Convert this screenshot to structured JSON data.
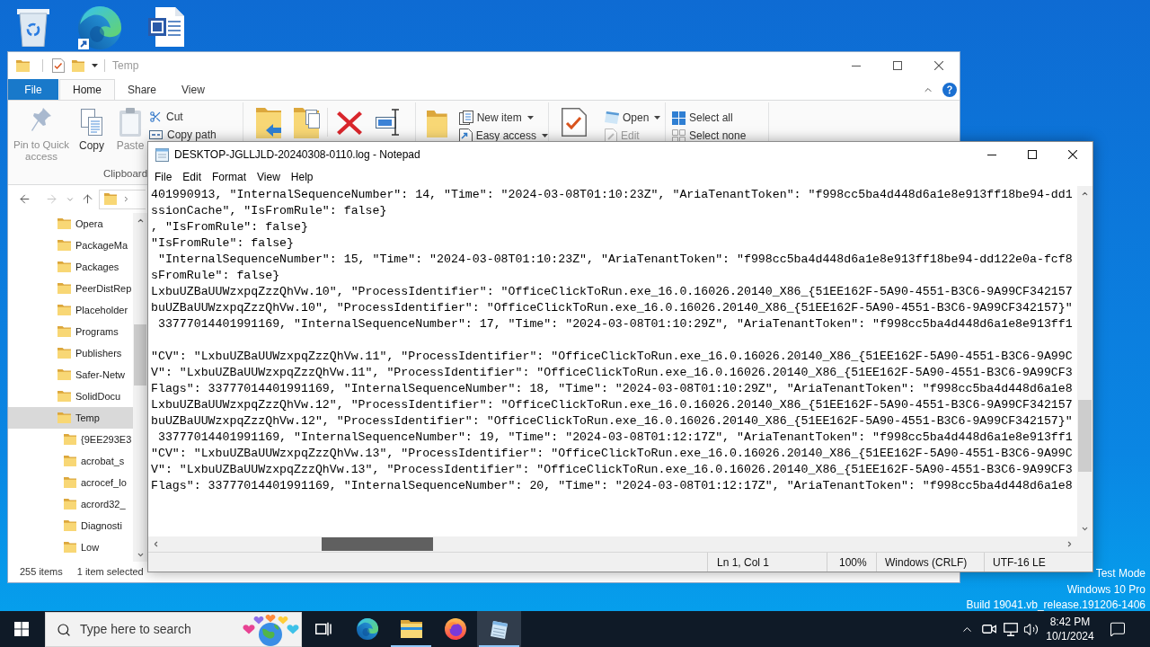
{
  "explorer": {
    "title": "Temp",
    "tabs": [
      {
        "label": "File",
        "kind": "file",
        "selected": false
      },
      {
        "label": "Home",
        "kind": "tab",
        "selected": true
      },
      {
        "label": "Share",
        "kind": "tab",
        "selected": false
      },
      {
        "label": "View",
        "kind": "tab",
        "selected": false
      }
    ],
    "ribbon": {
      "clipboard": {
        "label": "Clipboard",
        "pin": {
          "label": "Pin to Quick access",
          "disabled": true
        },
        "copy": {
          "label": "Copy",
          "disabled": false
        },
        "paste": {
          "label": "Paste",
          "disabled": true
        },
        "cut": {
          "label": "Cut",
          "disabled": false
        },
        "copy_path": {
          "label": "Copy path",
          "disabled": false
        }
      },
      "new": {
        "new_item": "New item",
        "easy_access": "Easy access"
      },
      "open": {
        "open": {
          "label": "Open",
          "disabled": false
        },
        "edit": {
          "label": "Edit",
          "disabled": true
        }
      },
      "select": {
        "select_all": "Select all",
        "select_none": "Select none"
      }
    },
    "tree": [
      {
        "label": "Opera",
        "selected": false
      },
      {
        "label": "PackageMa",
        "selected": false
      },
      {
        "label": "Packages",
        "selected": false
      },
      {
        "label": "PeerDistRep",
        "selected": false
      },
      {
        "label": "Placeholder",
        "selected": false
      },
      {
        "label": "Programs",
        "selected": false
      },
      {
        "label": "Publishers",
        "selected": false
      },
      {
        "label": "Safer-Netw",
        "selected": false
      },
      {
        "label": "SolidDocu",
        "selected": false
      },
      {
        "label": "Temp",
        "selected": true,
        "children": [
          {
            "label": "{9EE293E3",
            "selected": false
          },
          {
            "label": "acrobat_s",
            "selected": false
          },
          {
            "label": "acrocef_lo",
            "selected": false
          },
          {
            "label": "acrord32_",
            "selected": false
          },
          {
            "label": "Diagnosti",
            "selected": false
          },
          {
            "label": "Low",
            "selected": false
          }
        ]
      }
    ],
    "status_bar": {
      "count": "255 items",
      "selection": "1 item selected"
    }
  },
  "notepad": {
    "title": "DESKTOP-JGLLJLD-20240308-0110.log - Notepad",
    "menu": [
      "File",
      "Edit",
      "Format",
      "View",
      "Help"
    ],
    "blocks": [
      [
        "401990913, \"InternalSequenceNumber\": 14, \"Time\": \"2024-03-08T01:10:23Z\", \"AriaTenantToken\": \"f998cc5ba4d448d6a1e8e913ff18be94-dd1",
        "ssionCache\", \"IsFromRule\": false}",
        ", \"IsFromRule\": false}",
        "\"IsFromRule\": false}",
        " \"InternalSequenceNumber\": 15, \"Time\": \"2024-03-08T01:10:23Z\", \"AriaTenantToken\": \"f998cc5ba4d448d6a1e8e913ff18be94-dd122e0a-fcf8",
        "sFromRule\": false}",
        "LxbuUZBaUUWzxpqZzzQhVw.10\", \"ProcessIdentifier\": \"OfficeClickToRun.exe_16.0.16026.20140_X86_{51EE162F-5A90-4551-B3C6-9A99CF342157",
        "buUZBaUUWzxpqZzzQhVw.10\", \"ProcessIdentifier\": \"OfficeClickToRun.exe_16.0.16026.20140_X86_{51EE162F-5A90-4551-B3C6-9A99CF342157}\"",
        " 33777014401991169, \"InternalSequenceNumber\": 17, \"Time\": \"2024-03-08T01:10:29Z\", \"AriaTenantToken\": \"f998cc5ba4d448d6a1e8e913ff1"
      ],
      [
        "\"CV\": \"LxbuUZBaUUWzxpqZzzQhVw.11\", \"ProcessIdentifier\": \"OfficeClickToRun.exe_16.0.16026.20140_X86_{51EE162F-5A90-4551-B3C6-9A99C",
        "V\": \"LxbuUZBaUUWzxpqZzzQhVw.11\", \"ProcessIdentifier\": \"OfficeClickToRun.exe_16.0.16026.20140_X86_{51EE162F-5A90-4551-B3C6-9A99CF3",
        "Flags\": 33777014401991169, \"InternalSequenceNumber\": 18, \"Time\": \"2024-03-08T01:10:29Z\", \"AriaTenantToken\": \"f998cc5ba4d448d6a1e8",
        "LxbuUZBaUUWzxpqZzzQhVw.12\", \"ProcessIdentifier\": \"OfficeClickToRun.exe_16.0.16026.20140_X86_{51EE162F-5A90-4551-B3C6-9A99CF342157",
        "buUZBaUUWzxpqZzzQhVw.12\", \"ProcessIdentifier\": \"OfficeClickToRun.exe_16.0.16026.20140_X86_{51EE162F-5A90-4551-B3C6-9A99CF342157}\"",
        " 33777014401991169, \"InternalSequenceNumber\": 19, \"Time\": \"2024-03-08T01:12:17Z\", \"AriaTenantToken\": \"f998cc5ba4d448d6a1e8e913ff1",
        "\"CV\": \"LxbuUZBaUUWzxpqZzzQhVw.13\", \"ProcessIdentifier\": \"OfficeClickToRun.exe_16.0.16026.20140_X86_{51EE162F-5A90-4551-B3C6-9A99C",
        "V\": \"LxbuUZBaUUWzxpqZzzQhVw.13\", \"ProcessIdentifier\": \"OfficeClickToRun.exe_16.0.16026.20140_X86_{51EE162F-5A90-4551-B3C6-9A99CF3",
        "Flags\": 33777014401991169, \"InternalSequenceNumber\": 20, \"Time\": \"2024-03-08T01:12:17Z\", \"AriaTenantToken\": \"f998cc5ba4d448d6a1e8"
      ]
    ],
    "status_bar": [
      "Ln 1, Col 1",
      "100%",
      "Windows (CRLF)",
      "UTF-16 LE"
    ]
  },
  "desktop_notice": [
    "Test Mode",
    "Windows 10 Pro",
    "Build 19041.vb_release.191206-1406"
  ],
  "taskbar": {
    "search": {
      "placeholder": "Type here to search"
    },
    "apps": [
      {
        "kind": "edge",
        "selected": false,
        "running": false
      },
      {
        "kind": "explorer",
        "selected": false,
        "running": true
      },
      {
        "kind": "firefox",
        "selected": false,
        "running": false
      },
      {
        "kind": "notepad",
        "selected": true,
        "running": true
      }
    ],
    "clock": {
      "time": "8:42 PM",
      "date": "10/1/2024"
    }
  }
}
